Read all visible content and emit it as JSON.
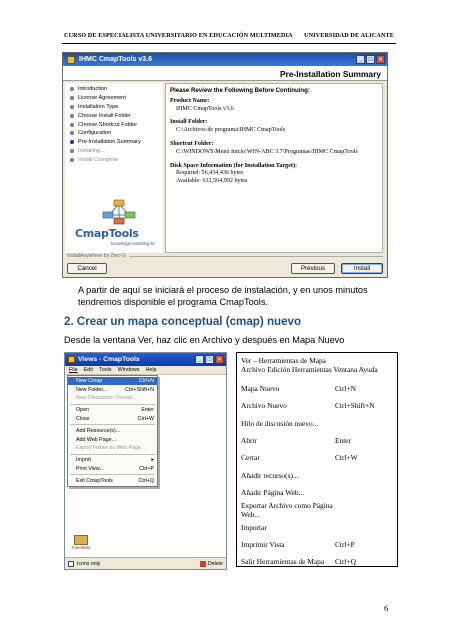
{
  "header": {
    "left": "CURSO DE ESPECIALISTA UNIVERSITARIO EN EDUCACIÓN MULTIMEDIA",
    "right": "UNIVERSIDAD DE ALICANTE"
  },
  "installer": {
    "window_title": "IHMC CmapTools v3.6",
    "banner": "Pre-Installation Summary",
    "steps": [
      {
        "label": "Introduction",
        "state": "done"
      },
      {
        "label": "License Agreement",
        "state": "done"
      },
      {
        "label": "Installation Type",
        "state": "done"
      },
      {
        "label": "Choose Install Folder",
        "state": "done"
      },
      {
        "label": "Choose Shortcut Folder",
        "state": "done"
      },
      {
        "label": "Configuration",
        "state": "done"
      },
      {
        "label": "Pre-Installation Summary",
        "state": "current"
      },
      {
        "label": "Installing...",
        "state": "pending"
      },
      {
        "label": "Install Complete",
        "state": "pending"
      }
    ],
    "logo_text": "CmapTools",
    "logo_sub": "knowledge modeling kit",
    "summary": {
      "intro": "Please Review the Following Before Continuing:",
      "product_name_label": "Product Name:",
      "product_name": "IHMC CmapTools v3.6",
      "install_folder_label": "Install Folder:",
      "install_folder": "C:\\Archivos de programa\\IHMC CmapTools",
      "shortcut_folder_label": "Shortcut Folder:",
      "shortcut_folder": "C:\\WINDOWS\\Menú Inicio\\WIN-ABC 3.7\\Programas\\IHMC CmapTools",
      "disk_space_label": "Disk Space Information (for Installation Target):",
      "required": "Required: 56,434,436 bytes",
      "available": "Available: 612,564,992 bytes"
    },
    "footer_text": "InstallAnywhere by Zero G",
    "buttons": {
      "cancel": "Cancel",
      "previous": "Previous",
      "install": "Install"
    }
  },
  "paragraph_1": "A partir de aquí se iniciará el proceso de instalación, y en unos minutos tendremos disponible el programa CmapTools.",
  "section_title": "2. Crear un mapa conceptual  (cmap) nuevo",
  "paragraph_2": "Desde la ventana Ver, haz clic en Archivo y después en Mapa Nuevo",
  "views_window": {
    "title": "Views - CmapTools",
    "menubar": [
      "File",
      "Edit",
      "Tools",
      "Windows",
      "Help"
    ],
    "menu_items": [
      {
        "label": "New Cmap",
        "shortcut": "Ctrl+N",
        "state": "highlighted"
      },
      {
        "label": "New Folder...",
        "shortcut": "Ctrl+Shift+N",
        "state": "normal"
      },
      {
        "label": "New Discussion Thread...",
        "shortcut": "",
        "state": "disabled"
      },
      {
        "sep": true
      },
      {
        "label": "Open",
        "shortcut": "Enter",
        "state": "normal"
      },
      {
        "label": "Close",
        "shortcut": "Ctrl+W",
        "state": "normal"
      },
      {
        "sep": true
      },
      {
        "label": "Add Resource(s)...",
        "shortcut": "",
        "state": "normal"
      },
      {
        "label": "Add Web Page...",
        "shortcut": "",
        "state": "normal"
      },
      {
        "label": "Export Folder as Web Page...",
        "shortcut": "",
        "state": "disabled"
      },
      {
        "sep": true
      },
      {
        "label": "Import",
        "shortcut": "▸",
        "state": "normal"
      },
      {
        "label": "Print View...",
        "shortcut": "Ctrl+P",
        "state": "normal"
      },
      {
        "sep": true
      },
      {
        "label": "Exit CmapTools",
        "shortcut": "Ctrl+Q",
        "state": "normal"
      }
    ],
    "favorites_label": "Favorites",
    "icons_only_label": "Icons only",
    "delete_label": "Delete"
  },
  "translation": {
    "title": "Ver – Herramientas de Mapa",
    "menubar": "Archivo  Edición  Herramientas  Ventana  Ayuda",
    "rows": [
      {
        "label": "Mapa Nuevo",
        "shortcut": "Ctrl+N"
      },
      {
        "label": "Archivo Nuevo",
        "shortcut": "Ctrl+Shift+N"
      },
      {
        "label": "Hilo de discusión nuevo...",
        "shortcut": ""
      },
      {
        "label": "Abrir",
        "shortcut": "Enter"
      },
      {
        "label": "Cerrar",
        "shortcut": "Ctrl+W"
      },
      {
        "label": "Añadir recurso(s)...",
        "shortcut": ""
      },
      {
        "label": "Añadir Página Web...",
        "shortcut": ""
      },
      {
        "label": "Exportar Archivo como Página Web...",
        "shortcut": ""
      },
      {
        "label": "Importar",
        "shortcut": ""
      },
      {
        "label": "Imprimir Vista",
        "shortcut": "Ctrl+P"
      },
      {
        "label": "Salir Herramientas de Mapa",
        "shortcut": "Ctrl+Q"
      },
      {
        "label": "",
        "shortcut": ""
      },
      {
        "label": "Favoritos",
        "shortcut": ""
      }
    ]
  },
  "page_number": "6"
}
